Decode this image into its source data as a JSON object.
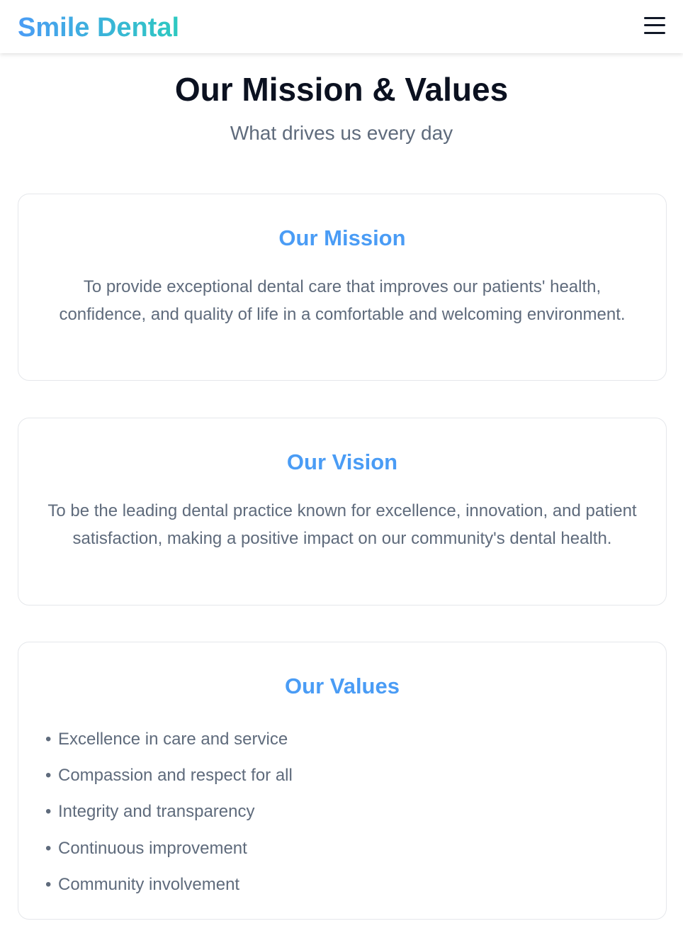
{
  "navbar": {
    "brand": "Smile Dental",
    "menu_icon": "hamburger-menu-icon"
  },
  "header": {
    "title": "Our Mission & Values",
    "subtitle": "What drives us every day"
  },
  "mission": {
    "title": "Our Mission",
    "text": "To provide exceptional dental care that improves our patients' health, confidence, and quality of life in a comfortable and welcoming environment."
  },
  "vision": {
    "title": "Our Vision",
    "text": "To be the leading dental practice known for excellence, innovation, and patient satisfaction, making a positive impact on our community's dental health."
  },
  "values": {
    "title": "Our Values",
    "bullet": "•",
    "items": [
      "Excellence in care and service",
      "Compassion and respect for all",
      "Integrity and transparency",
      "Continuous improvement",
      "Community involvement"
    ]
  },
  "colors": {
    "brand_gradient_start": "#4a9cf5",
    "brand_gradient_end": "#2dc9c0",
    "accent": "#4a9cf5",
    "heading": "#0b1120",
    "body_text": "#5f6b7c",
    "card_border": "#e5e7eb"
  }
}
